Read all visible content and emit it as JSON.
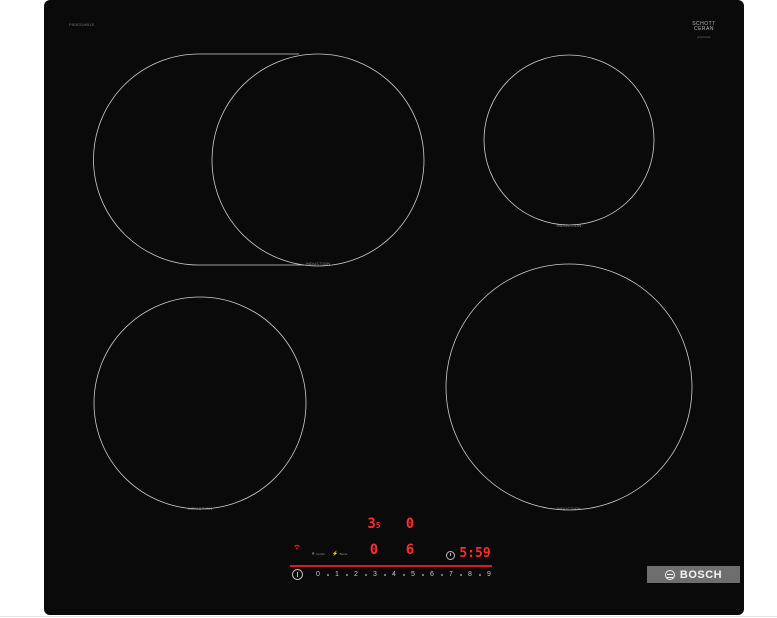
{
  "hob": {
    "model_code": "PIE631HB1E",
    "brand": "BOSCH",
    "glass_brand_line1": "SCHOTT",
    "glass_brand_line2": "CERAN",
    "glass_brand_sub": "premium"
  },
  "zones": [
    {
      "id": "front-left",
      "label": "INDUCTION"
    },
    {
      "id": "rear-left-flex",
      "label": "INDUCTION"
    },
    {
      "id": "rear-right",
      "label": "INDUCTION"
    },
    {
      "id": "front-right",
      "label": "INDUCTION"
    }
  ],
  "displays": {
    "rear_left": "3",
    "rear_left_sub": "5",
    "rear_right": "0",
    "front_left": "0",
    "front_right": "6",
    "timer": "5:59"
  },
  "controls": {
    "wifi_label": "",
    "combi_label": "Combi",
    "boost_label": "Boost",
    "slider_values": [
      "0",
      "1",
      "2",
      "3",
      "4",
      "5",
      "6",
      "7",
      "8",
      "9"
    ]
  },
  "colors": {
    "glass": "#0a0a0a",
    "display_red": "#ff2b2b",
    "badge_gray": "#6e6e6e"
  }
}
